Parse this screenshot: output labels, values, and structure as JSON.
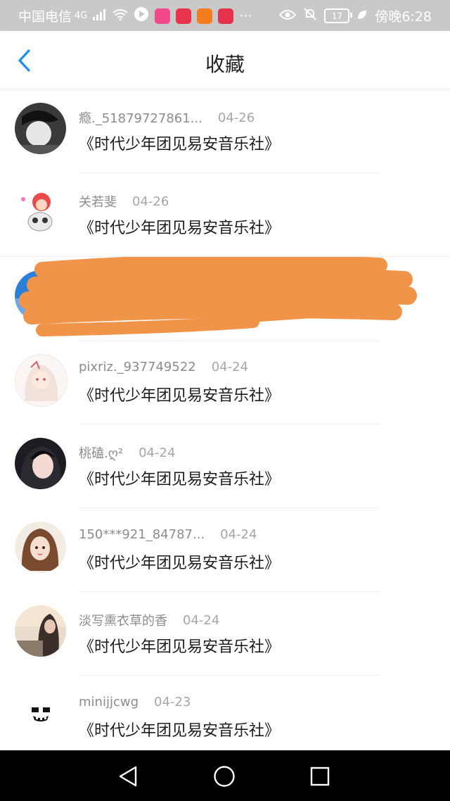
{
  "status_bar": {
    "carrier": "中国电信",
    "signal_label": "4G",
    "battery_level": "17",
    "time": "傍晚6:28",
    "more": "···"
  },
  "header": {
    "title": "收藏",
    "back_icon": "chevron-left-icon"
  },
  "items": [
    {
      "name": "瘾._51879727861...",
      "date": "04-26",
      "title": "《时代少年团见易安音乐社》"
    },
    {
      "name": "关若斐",
      "date": "04-26",
      "title": "《时代少年团见易安音乐社》"
    },
    {
      "redacted": true
    },
    {
      "name": "pixriz._937749522",
      "date": "04-24",
      "title": "《时代少年团见易安音乐社》"
    },
    {
      "name": "桃磕.ღ²",
      "date": "04-24",
      "title": "《时代少年团见易安音乐社》"
    },
    {
      "name": "150***921_84787...",
      "date": "04-24",
      "title": "《时代少年团见易安音乐社》"
    },
    {
      "name": "淡写熏衣草的香",
      "date": "04-24",
      "title": "《时代少年团见易安音乐社》"
    },
    {
      "name": "minijjcwg",
      "date": "04-23",
      "title": "《时代少年团见易安音乐社》"
    }
  ],
  "colors": {
    "accent": "#1e8cf0",
    "scribble": "#f0944a",
    "statusbar": "#c9c9c9"
  }
}
